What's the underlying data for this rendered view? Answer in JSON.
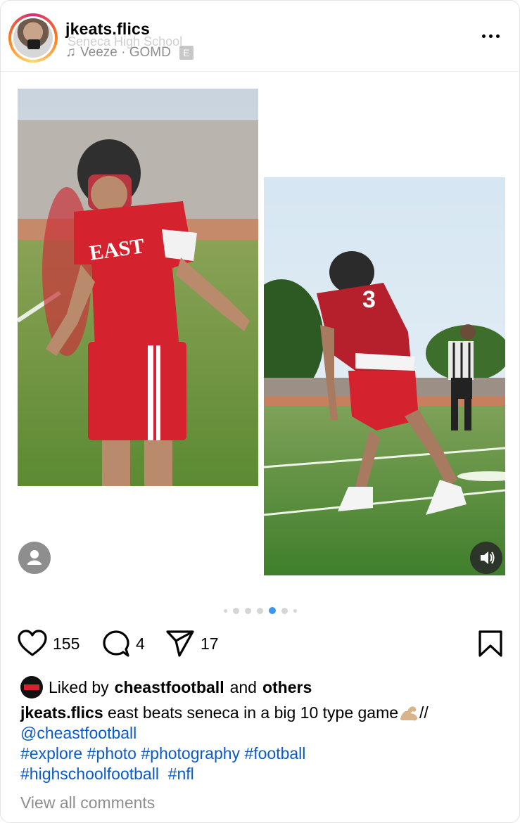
{
  "post": {
    "username": "jkeats.flics",
    "location": "Seneca High School",
    "music": "Veeze · GOMD",
    "explicit_badge": "E"
  },
  "actions": {
    "likes": "155",
    "comments": "4",
    "shares": "17"
  },
  "carousel": {
    "total": 7,
    "active_index": 4
  },
  "liked_by": {
    "prefix": "Liked by",
    "user": "cheastfootball",
    "joiner": "and",
    "suffix": "others"
  },
  "caption": {
    "username": "jkeats.flics",
    "text": "east beats seneca in a big 10 type game",
    "separator": "//",
    "mention": "@cheastfootball",
    "hashtags_line1": "#explore #photo #photography #football",
    "hashtags_line2": "#highschoolfootball  #nfl"
  },
  "comments_link": "View all comments",
  "colors": {
    "accent_blue": "#3897f0",
    "link_blue": "#0a5bc9",
    "jersey_red": "#d4222f",
    "muted_gray": "#8e8e8e"
  },
  "icons": {
    "like": "heart-icon",
    "comment": "comment-icon",
    "share": "paper-plane-icon",
    "save": "bookmark-icon",
    "more": "more-horizontal-icon",
    "music": "music-note-icon",
    "sound": "speaker-icon",
    "tags": "user-tag-icon"
  }
}
